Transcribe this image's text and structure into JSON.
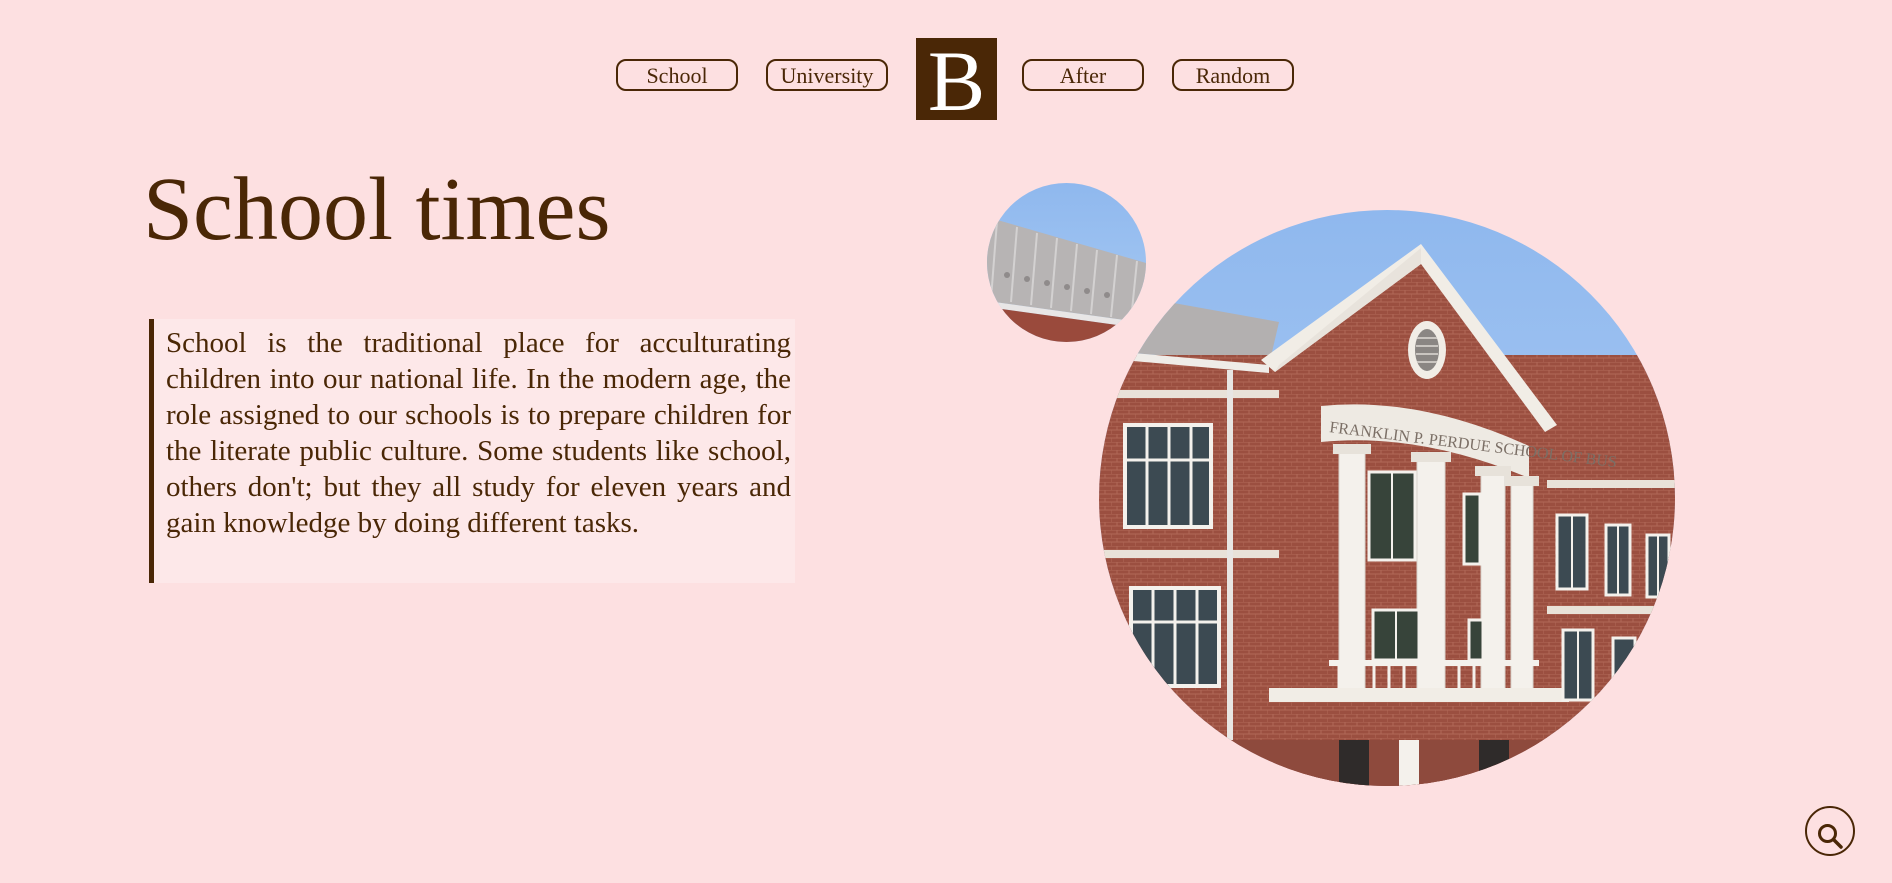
{
  "nav": {
    "items": [
      {
        "label": "School"
      },
      {
        "label": "University"
      },
      {
        "label": "After"
      },
      {
        "label": "Random"
      }
    ],
    "logo_letter": "B"
  },
  "main": {
    "title": "School times",
    "intro": "School is the traditional place for acculturating children into our national life. In the modern age, the role assigned to our schools is to prepare children for the literate public culture. Some students like school, others don't; but they all study for eleven years and gain knowledge by doing different tasks."
  },
  "image": {
    "sign_text": "FRANKLIN P. PERDUE SCHOOL OF BUS"
  },
  "icons": {
    "search": "search-icon"
  },
  "colors": {
    "background": "#fde0e1",
    "accent": "#4a2706",
    "text_block_background": "#fde8e9"
  }
}
